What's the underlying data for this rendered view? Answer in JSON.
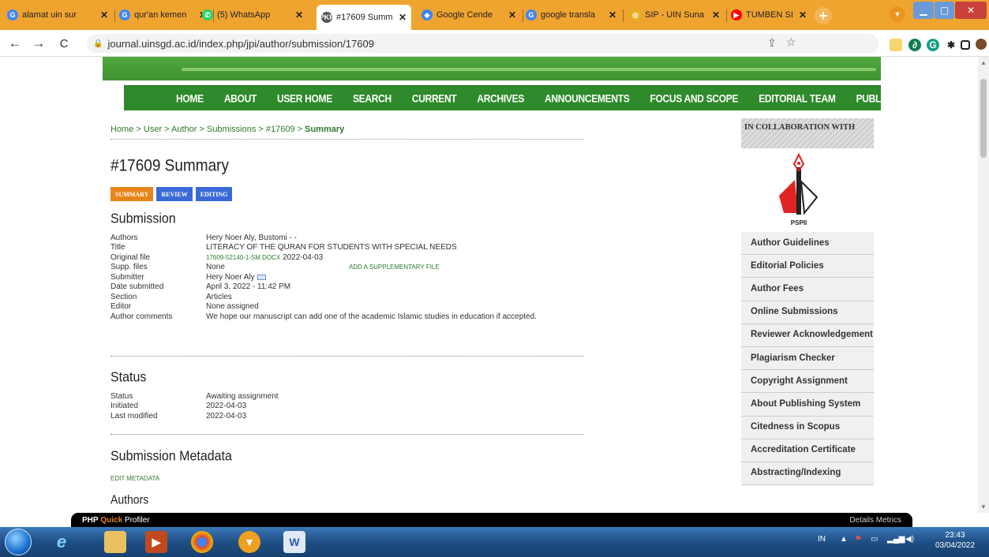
{
  "browser": {
    "tabs": [
      {
        "label": "alamat uin sur",
        "fav": "G",
        "color": "#4285f4"
      },
      {
        "label": "qur'an kemen",
        "fav": "G",
        "color": "#4285f4"
      },
      {
        "label": "(5) WhatsApp",
        "fav": "✆",
        "color": "#25d366"
      },
      {
        "label": "#17609 Summ",
        "fav": "PKP",
        "color": "#555"
      },
      {
        "label": "Google Cende",
        "fav": "◆",
        "color": "#3b82f6"
      },
      {
        "label": "google transla",
        "fav": "G",
        "color": "#4285f4"
      },
      {
        "label": "SIP - UIN Suna",
        "fav": "◎",
        "color": "#e0b020"
      },
      {
        "label": "TUMBEN SI JO",
        "fav": "▶",
        "color": "#ff0000"
      }
    ],
    "tab_close": "✕",
    "new_tab": "+",
    "url": "journal.uinsgd.ac.id/index.php/jpi/author/submission/17609"
  },
  "nav": [
    "HOME",
    "ABOUT",
    "USER HOME",
    "SEARCH",
    "CURRENT",
    "ARCHIVES",
    "ANNOUNCEMENTS",
    "FOCUS AND SCOPE",
    "EDITORIAL TEAM",
    "PUBLICATION ETHIC"
  ],
  "breadcrumb": {
    "trail": "Home > User > Author > Submissions > #17609 >",
    "current": "Summary"
  },
  "page_title": "#17609 Summary",
  "subtabs": [
    {
      "label": "SUMMARY",
      "color": "#e8851a"
    },
    {
      "label": "REVIEW",
      "color": "#3a6ad8"
    },
    {
      "label": "EDITING",
      "color": "#3a6ad8"
    }
  ],
  "submission": {
    "heading": "Submission",
    "rows": [
      {
        "k": "Authors",
        "v": "Hery Noer Aly, Bustomi - -"
      },
      {
        "k": "Title",
        "v": "LITERACY OF THE QURAN FOR STUDENTS WITH SPECIAL NEEDS"
      },
      {
        "k": "Original file",
        "file": "17609-52140-1-SM.DOCX",
        "v": "2022-04-03"
      },
      {
        "k": "Supp. files",
        "v": "None",
        "action": "ADD A SUPPLEMENTARY FILE"
      },
      {
        "k": "Submitter",
        "v": "Hery Noer Aly"
      },
      {
        "k": "Date submitted",
        "v": "April 3, 2022 - 11:42 PM"
      },
      {
        "k": "Section",
        "v": "Articles"
      },
      {
        "k": "Editor",
        "v": "None assigned"
      },
      {
        "k": "Author comments",
        "v": "We hope our manuscript can add one of the academic Islamic studies in education if accepted."
      }
    ]
  },
  "status": {
    "heading": "Status",
    "rows": [
      {
        "k": "Status",
        "v": "Awaiting assignment"
      },
      {
        "k": "Initiated",
        "v": "2022-04-03"
      },
      {
        "k": "Last modified",
        "v": "2022-04-03"
      }
    ]
  },
  "metadata": {
    "heading": "Submission Metadata",
    "edit": "EDIT METADATA",
    "authors_heading": "Authors"
  },
  "sidebar": {
    "collab": "IN COLLABORATION WITH",
    "logo_text": "PSPII",
    "links": [
      "Author Guidelines",
      "Editorial Policies",
      "Author Fees",
      "Online Submissions",
      "Reviewer Acknowledgement",
      "Plagiarism Checker",
      "Copyright Assignment",
      "About Publishing System",
      "Citedness in Scopus",
      "Accreditation Certificate",
      "Abstracting/Indexing"
    ]
  },
  "profiler": {
    "php": "PHP",
    "quick": "Quick",
    "rest": "Profiler",
    "right": "Details  Metrics"
  },
  "taskbar": {
    "lang": "IN",
    "time": "23:43",
    "date": "03/04/2022"
  }
}
